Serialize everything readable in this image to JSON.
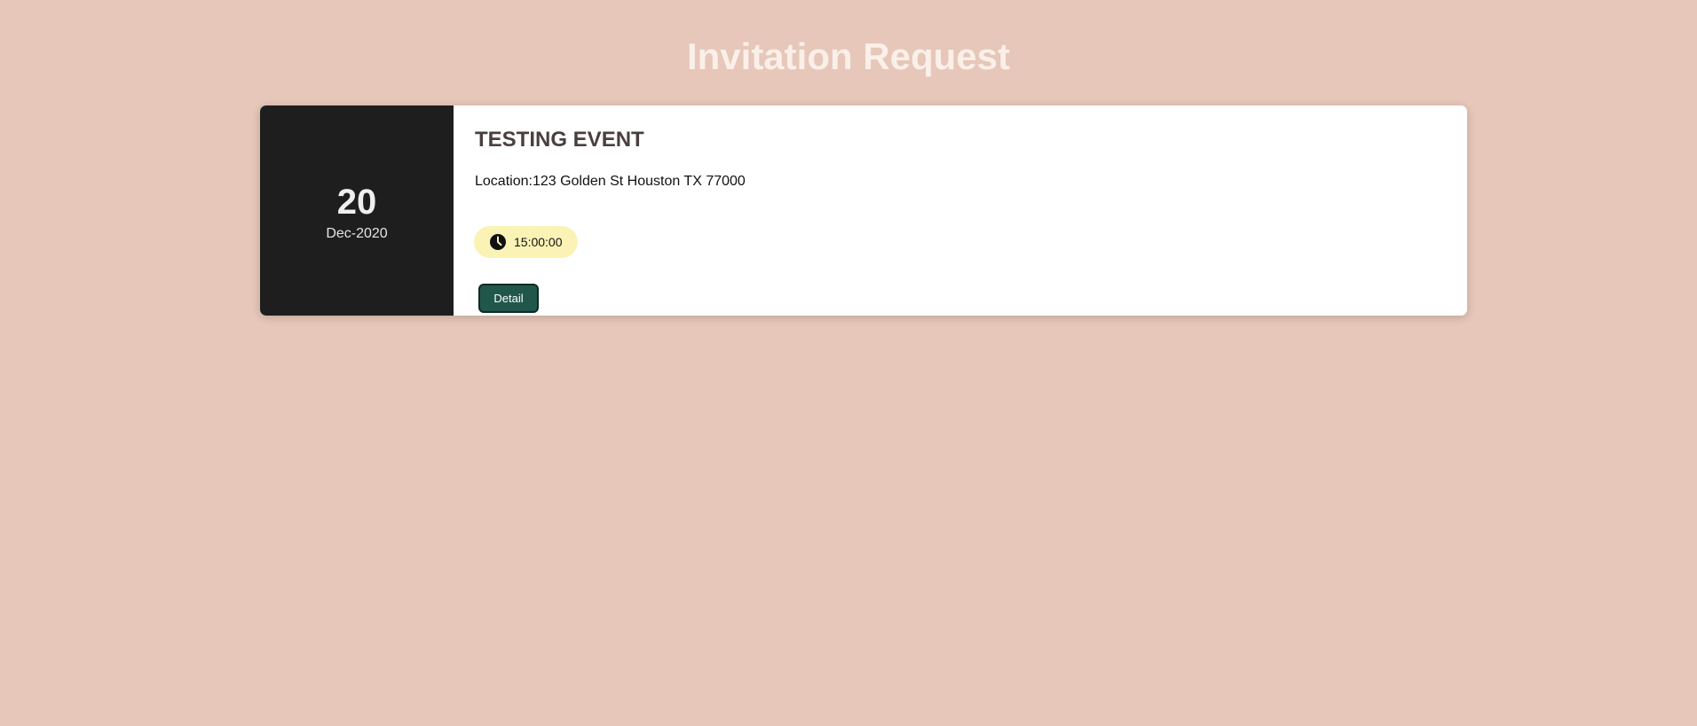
{
  "header": {
    "title": "Invitation Request"
  },
  "event": {
    "day": "20",
    "month_year": "Dec-2020",
    "name": "TESTING EVENT",
    "location": "Location:123 Golden St Houston TX 77000",
    "time": "15:00:00",
    "time_icon": "clock-icon",
    "detail_label": "Detail"
  },
  "colors": {
    "background": "#e6c7b9",
    "date_panel": "#1e1e1e",
    "time_pill": "#fbf3b5",
    "button": "#21574a"
  }
}
